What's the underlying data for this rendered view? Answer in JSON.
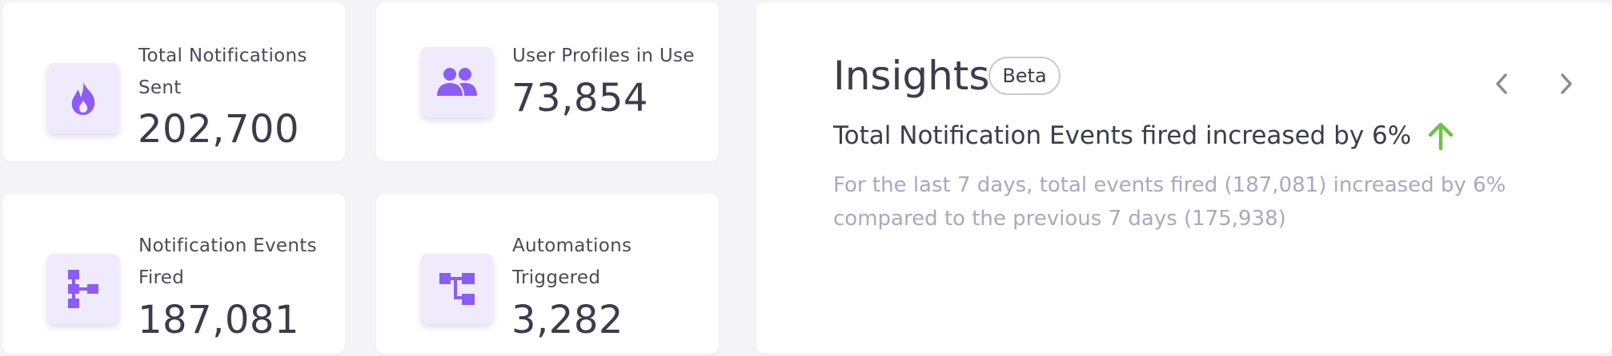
{
  "stats": [
    {
      "label": "Total Notifications Sent",
      "value": "202,700",
      "icon": "flame-icon"
    },
    {
      "label": "User Profiles in Use",
      "value": "73,854",
      "icon": "users-icon"
    },
    {
      "label": "Notification Events Fired",
      "value": "187,081",
      "icon": "hierarchy-icon"
    },
    {
      "label": "Automations Triggered",
      "value": "3,282",
      "icon": "workflow-icon"
    }
  ],
  "insights": {
    "title": "Insights",
    "badge": "Beta",
    "headline": "Total Notification Events fired increased by 6%",
    "description": "For the last 7 days, total events fired (187,081) increased by 6% compared to the previous 7 days (175,938)",
    "trend": "up"
  },
  "colors": {
    "accent": "#8b5cf6",
    "icon_bg": "#efebfd",
    "up_arrow": "#6cc24a",
    "muted_text": "#aaa8c0"
  }
}
